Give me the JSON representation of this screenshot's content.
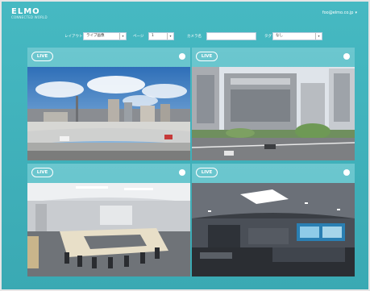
{
  "header": {
    "logo": "ELMO",
    "logo_sub": "CONNECTED WORLD",
    "user": "foo@elmo.co.jp",
    "user_caret": "▾"
  },
  "toolbar": {
    "layout_label": "レイアウト",
    "layout_value": "ライブ画像",
    "page_label": "ページ",
    "page_value": "1",
    "camera_label": "カメラ名",
    "camera_value": "",
    "tag_label": "タグ",
    "tag_value": "なし",
    "dropdown_arrow": "▾"
  },
  "tiles": [
    {
      "badge": "LIVE",
      "scene": "city-skyline"
    },
    {
      "badge": "LIVE",
      "scene": "street-buildings"
    },
    {
      "badge": "LIVE",
      "scene": "meeting-room"
    },
    {
      "badge": "LIVE",
      "scene": "showroom"
    }
  ],
  "colors": {
    "background": "#3fb1ba",
    "tile": "#6cc7cf",
    "badge": "#ffffff"
  }
}
